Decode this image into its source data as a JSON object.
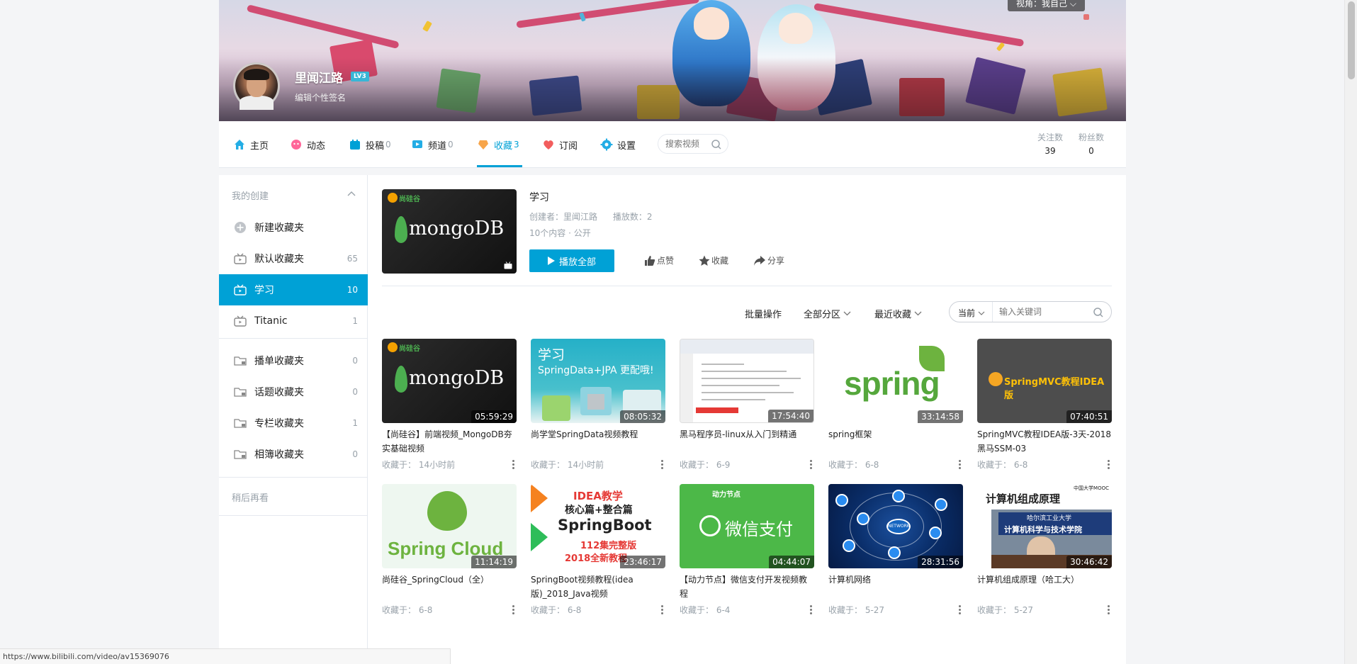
{
  "colors": {
    "accent": "#00a1d6",
    "muted": "#99a2aa",
    "border": "#e5e9ef"
  },
  "banner": {
    "view_as": "视角：我自己",
    "username": "里闻江路",
    "level": "LV3",
    "signature": "编辑个性签名"
  },
  "nav": {
    "items": [
      {
        "label": "主页",
        "count": "",
        "icon": "home-icon"
      },
      {
        "label": "动态",
        "count": "",
        "icon": "dynamic-icon"
      },
      {
        "label": "投稿",
        "count": "0",
        "icon": "upload-icon"
      },
      {
        "label": "频道",
        "count": "0",
        "icon": "channel-icon"
      },
      {
        "label": "收藏",
        "count": "3",
        "icon": "favorite-icon"
      },
      {
        "label": "订阅",
        "count": "",
        "icon": "heart-icon"
      },
      {
        "label": "设置",
        "count": "",
        "icon": "gear-icon"
      }
    ],
    "search_placeholder": "搜索视频",
    "following_label": "关注数",
    "following_value": "39",
    "followers_label": "粉丝数",
    "followers_value": "0"
  },
  "sidebar": {
    "group_title": "我的创建",
    "new_folder": "新建收藏夹",
    "folders": [
      {
        "label": "默认收藏夹",
        "count": "65"
      },
      {
        "label": "学习",
        "count": "10"
      },
      {
        "label": "Titanic",
        "count": "1"
      }
    ],
    "categories": [
      {
        "label": "播单收藏夹",
        "count": "0"
      },
      {
        "label": "话题收藏夹",
        "count": "0"
      },
      {
        "label": "专栏收藏夹",
        "count": "1"
      },
      {
        "label": "相簿收藏夹",
        "count": "0"
      }
    ],
    "watch_later": "稍后再看"
  },
  "folder": {
    "title": "学习",
    "creator": "创建者：里闻江路",
    "plays": "播放数：2",
    "meta2": "10个内容 · 公开",
    "play_all": "播放全部",
    "like": "点赞",
    "collect": "收藏",
    "share": "分享",
    "cover_text": "mongoDB"
  },
  "filters": {
    "batch": "批量操作",
    "partition": "全部分区",
    "sort": "最近收藏",
    "scope": "当前",
    "keyword_placeholder": "输入关键词"
  },
  "videos": [
    {
      "title": "【尚硅谷】前端视频_MongoDB夯实基础视频",
      "duration": "05:59:29",
      "fav": "收藏于： 14小时前",
      "thumb": "mongo"
    },
    {
      "title": "尚学堂SpringData视频教程",
      "duration": "08:05:32",
      "fav": "收藏于： 14小时前",
      "thumb": "spring-data"
    },
    {
      "title": "黑马程序员-linux从入门到精通",
      "duration": "17:54:40",
      "fav": "收藏于： 6-9",
      "thumb": "linux"
    },
    {
      "title": "spring框架",
      "duration": "33:14:58",
      "fav": "收藏于： 6-8",
      "thumb": "spring"
    },
    {
      "title": "SpringMVC教程IDEA版-3天-2018黑马SSM-03",
      "duration": "07:40:51",
      "fav": "收藏于： 6-8",
      "thumb": "springmvc"
    },
    {
      "title": "尚硅谷_SpringCloud（全）",
      "duration": "11:14:19",
      "fav": "收藏于： 6-8",
      "thumb": "cloud"
    },
    {
      "title": "SpringBoot视频教程(idea版)_2018_Java视频",
      "duration": "23:46:17",
      "fav": "收藏于： 6-8",
      "thumb": "boot"
    },
    {
      "title": "【动力节点】微信支付开发视频教程",
      "duration": "04:44:07",
      "fav": "收藏于： 6-4",
      "thumb": "wechat"
    },
    {
      "title": "计算机网络",
      "duration": "28:31:56",
      "fav": "收藏于： 5-27",
      "thumb": "net"
    },
    {
      "title": "计算机组成原理（哈工大）",
      "duration": "30:46:42",
      "fav": "收藏于： 5-27",
      "thumb": "org"
    }
  ],
  "thumb_text": {
    "mongo_brand": "尚硅谷",
    "mongo": "mongoDB",
    "sd_line1": "学习",
    "sd_line2": "SpringData+JPA 更配哦!",
    "spring": "spring",
    "springmvc": "SpringMVC教程IDEA版",
    "cloud": "Spring Cloud",
    "boot1": "IDEA教学",
    "boot2": "核心篇+整合篇",
    "boot3": "SpringBoot",
    "boot4": "112集完整版",
    "boot5": "2018全新教程",
    "wechat_brand": "动力节点",
    "wechat": "微信支付",
    "net_center": "NETWORK",
    "org_title": "计算机组成原理",
    "org_banner_small": "哈尔滨工业大学",
    "org_banner": "计算机科学与技术学院",
    "org_tiny": "中国大学MOOC"
  },
  "status_url": "https://www.bilibili.com/video/av15369076"
}
